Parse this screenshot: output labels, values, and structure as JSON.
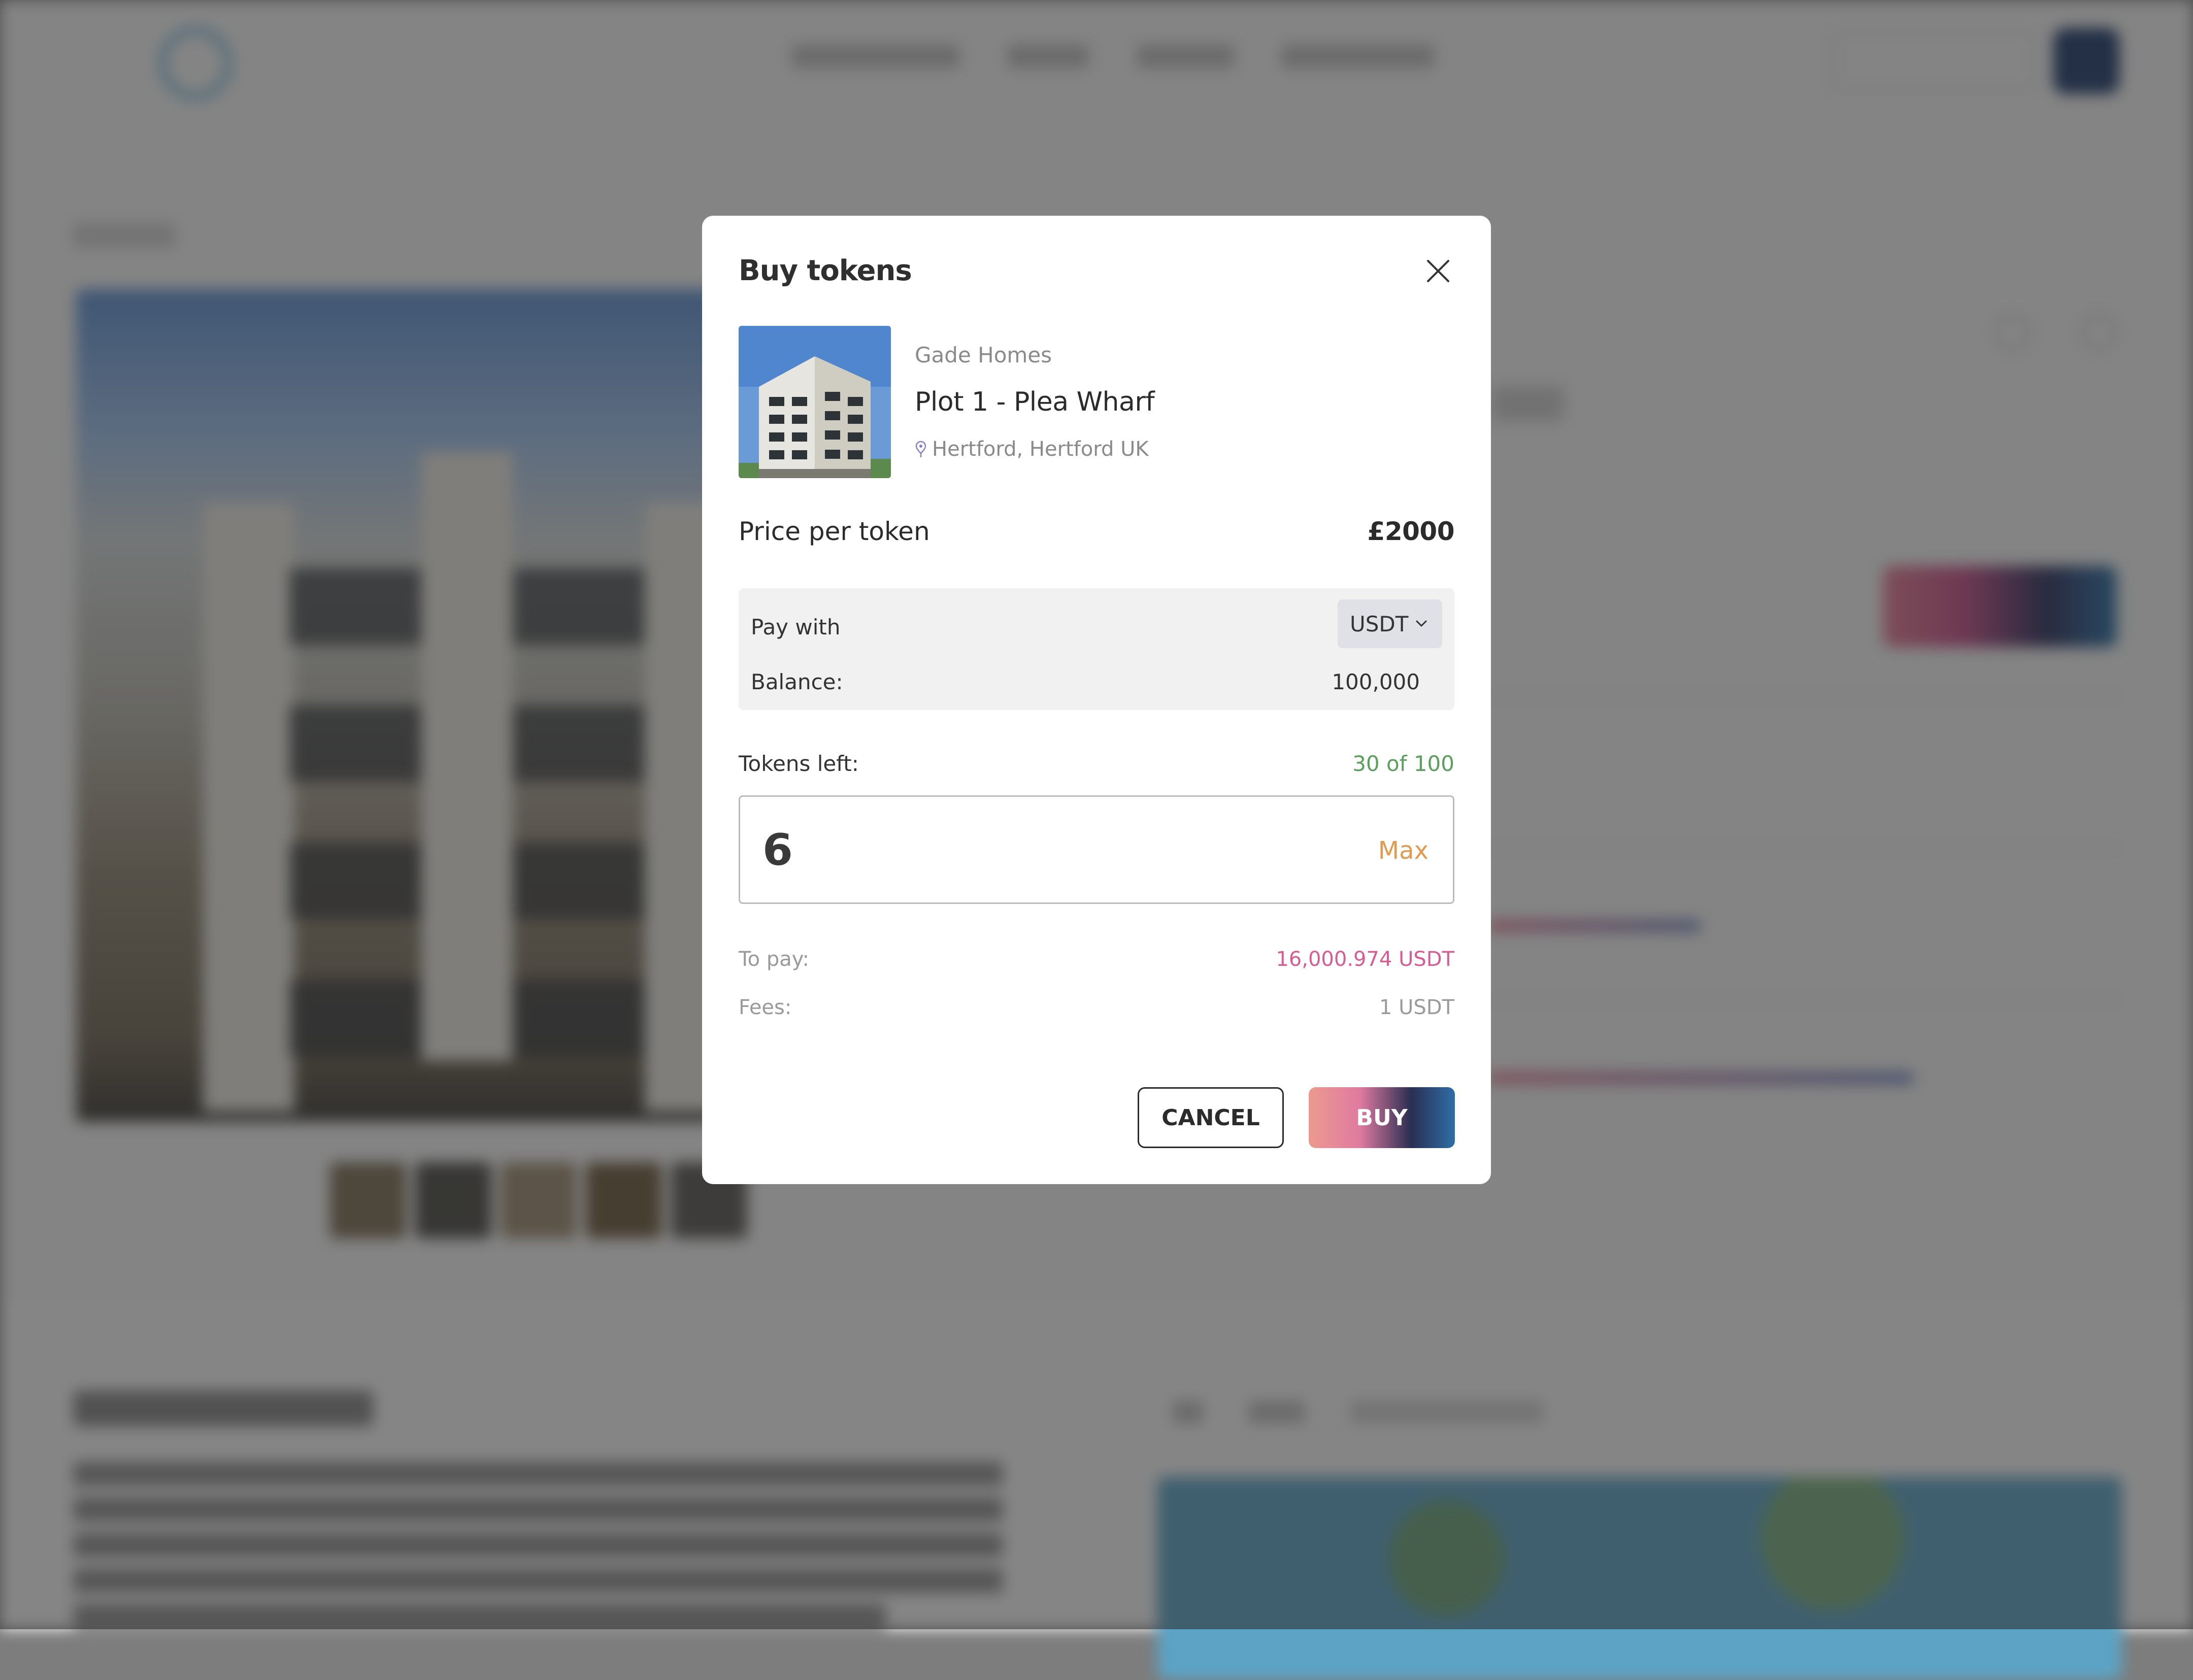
{
  "modal": {
    "title": "Buy tokens",
    "property": {
      "developer": "Gade Homes",
      "name": "Plot 1 - Plea Wharf",
      "location": "Hertford, Hertford UK"
    },
    "price_label": "Price per token",
    "price_value": "£2000",
    "payment": {
      "pay_with_label": "Pay with",
      "currency": "USDT",
      "balance_label": "Balance:",
      "balance_value": "100,000"
    },
    "tokens_left_label": "Tokens left:",
    "tokens_left_value": "30 of 100",
    "quantity_value": "6",
    "max_label": "Max",
    "to_pay_label": "To pay:",
    "to_pay_value": "16,000.974 USDT",
    "fees_label": "Fees:",
    "fees_value": "1 USDT",
    "cancel_label": "CANCEL",
    "buy_label": "BUY"
  },
  "colors": {
    "tokens_left": "#5aa05a",
    "max": "#e29a4e",
    "to_pay": "#d85c94",
    "buy_gradient_start": "#ec9a8f",
    "buy_gradient_end": "#2f6ea6"
  },
  "icons": {
    "close": "close-icon",
    "location": "location-pin-icon",
    "dropdown": "chevron-down-icon"
  }
}
